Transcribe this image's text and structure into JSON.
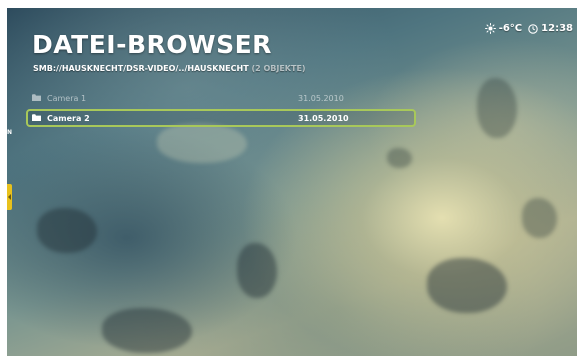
{
  "header": {
    "title": "DATEI-BROWSER",
    "path": "SMB://HAUSKNECHT/DSR-VIDEO/../HAUSKNECHT",
    "object_count": "(2 OBJEKTE)"
  },
  "status": {
    "weather_icon": "sun-icon",
    "temperature": "-6°C",
    "clock_icon": "clock-icon",
    "time": "12:38"
  },
  "files": [
    {
      "name": "Camera 1",
      "date": "31.05.2010",
      "type": "folder",
      "selected": false
    },
    {
      "name": "Camera 2",
      "date": "31.05.2010",
      "type": "folder",
      "selected": true
    }
  ],
  "sidebar": {
    "indicator_letter": "N"
  },
  "colors": {
    "selection_border": "#a8c85a",
    "side_tab": "#e8c11c",
    "text": "#ffffff"
  }
}
